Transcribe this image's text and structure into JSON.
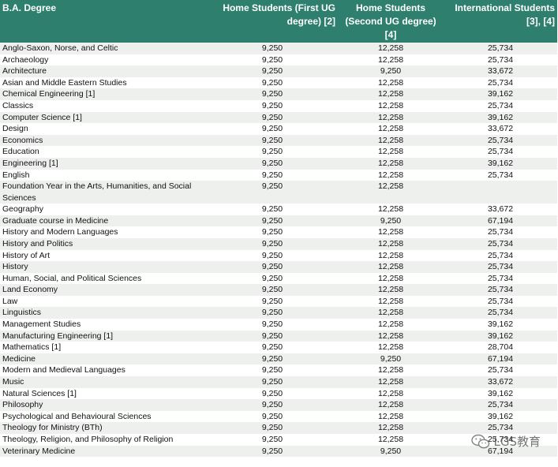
{
  "table": {
    "headers": {
      "degree": "B.A. Degree",
      "home_first": "Home Students (First UG degree) [2]",
      "home_second": "Home Students (Second UG degree) [4]",
      "international": "International Students [3], [4]"
    },
    "rows": [
      {
        "degree": "Anglo-Saxon, Norse, and Celtic",
        "home_first": "9,250",
        "home_second": "12,258",
        "international": "25,734"
      },
      {
        "degree": "Archaeology",
        "home_first": "9,250",
        "home_second": "12,258",
        "international": "25,734"
      },
      {
        "degree": "Architecture",
        "home_first": "9,250",
        "home_second": "9,250",
        "international": "33,672"
      },
      {
        "degree": "Asian and Middle Eastern Studies",
        "home_first": "9,250",
        "home_second": "12,258",
        "international": "25,734"
      },
      {
        "degree": "Chemical Engineering [1]",
        "home_first": "9,250",
        "home_second": "12,258",
        "international": "39,162"
      },
      {
        "degree": "Classics",
        "home_first": "9,250",
        "home_second": "12,258",
        "international": "25,734"
      },
      {
        "degree": "Computer Science [1]",
        "home_first": "9,250",
        "home_second": "12,258",
        "international": "39,162"
      },
      {
        "degree": "Design",
        "home_first": "9,250",
        "home_second": "12,258",
        "international": "33,672"
      },
      {
        "degree": "Economics",
        "home_first": "9,250",
        "home_second": "12,258",
        "international": "25,734"
      },
      {
        "degree": "Education",
        "home_first": "9,250",
        "home_second": "12,258",
        "international": "25,734"
      },
      {
        "degree": "Engineering [1]",
        "home_first": "9,250",
        "home_second": "12,258",
        "international": "39,162"
      },
      {
        "degree": "English",
        "home_first": "9,250",
        "home_second": "12,258",
        "international": "25,734"
      },
      {
        "degree": "Foundation Year in the Arts, Humanities, and Social Sciences",
        "home_first": "9,250",
        "home_second": "12,258",
        "international": ""
      },
      {
        "degree": "Geography",
        "home_first": "9,250",
        "home_second": "12,258",
        "international": "33,672"
      },
      {
        "degree": "Graduate course in Medicine",
        "home_first": "9,250",
        "home_second": "9,250",
        "international": "67,194"
      },
      {
        "degree": "History and Modern Languages",
        "home_first": "9,250",
        "home_second": "12,258",
        "international": "25,734"
      },
      {
        "degree": "History and Politics",
        "home_first": "9,250",
        "home_second": "12,258",
        "international": "25,734"
      },
      {
        "degree": "History of Art",
        "home_first": "9,250",
        "home_second": "12,258",
        "international": "25,734"
      },
      {
        "degree": "History",
        "home_first": "9,250",
        "home_second": "12,258",
        "international": "25,734"
      },
      {
        "degree": "Human, Social, and Political Sciences",
        "home_first": "9,250",
        "home_second": "12,258",
        "international": "25,734"
      },
      {
        "degree": "Land Economy",
        "home_first": "9,250",
        "home_second": "12,258",
        "international": "25,734"
      },
      {
        "degree": "Law",
        "home_first": "9,250",
        "home_second": "12,258",
        "international": "25,734"
      },
      {
        "degree": "Linguistics",
        "home_first": "9,250",
        "home_second": "12,258",
        "international": "25,734"
      },
      {
        "degree": "Management Studies",
        "home_first": "9,250",
        "home_second": "12,258",
        "international": "39,162"
      },
      {
        "degree": "Manufacturing Engineering [1]",
        "home_first": "9,250",
        "home_second": "12,258",
        "international": "39,162"
      },
      {
        "degree": "Mathematics [1]",
        "home_first": "9,250",
        "home_second": "12,258",
        "international": "28,704"
      },
      {
        "degree": "Medicine",
        "home_first": "9,250",
        "home_second": "9,250",
        "international": "67,194"
      },
      {
        "degree": "Modern and Medieval Languages",
        "home_first": "9,250",
        "home_second": "12,258",
        "international": "25,734"
      },
      {
        "degree": "Music",
        "home_first": "9,250",
        "home_second": "12,258",
        "international": "33,672"
      },
      {
        "degree": "Natural Sciences [1]",
        "home_first": "9,250",
        "home_second": "12,258",
        "international": "39,162"
      },
      {
        "degree": "Philosophy",
        "home_first": "9,250",
        "home_second": "12,258",
        "international": "25,734"
      },
      {
        "degree": "Psychological and Behavioural Sciences",
        "home_first": "9,250",
        "home_second": "12,258",
        "international": "39,162"
      },
      {
        "degree": "Theology for Ministry (BTh)",
        "home_first": "9,250",
        "home_second": "12,258",
        "international": "25,734"
      },
      {
        "degree": "Theology, Religion, and Philosophy of Religion",
        "home_first": "9,250",
        "home_second": "12,258",
        "international": "25,734"
      },
      {
        "degree": "Veterinary Medicine",
        "home_first": "9,250",
        "home_second": "9,250",
        "international": "67,194"
      }
    ]
  },
  "watermark": {
    "text": "LGS教育",
    "icon": "wechat-icon"
  },
  "colors": {
    "header_bg": "#2f7f6e",
    "header_text": "#ffffff",
    "row_stripe": "#eef0ee"
  }
}
